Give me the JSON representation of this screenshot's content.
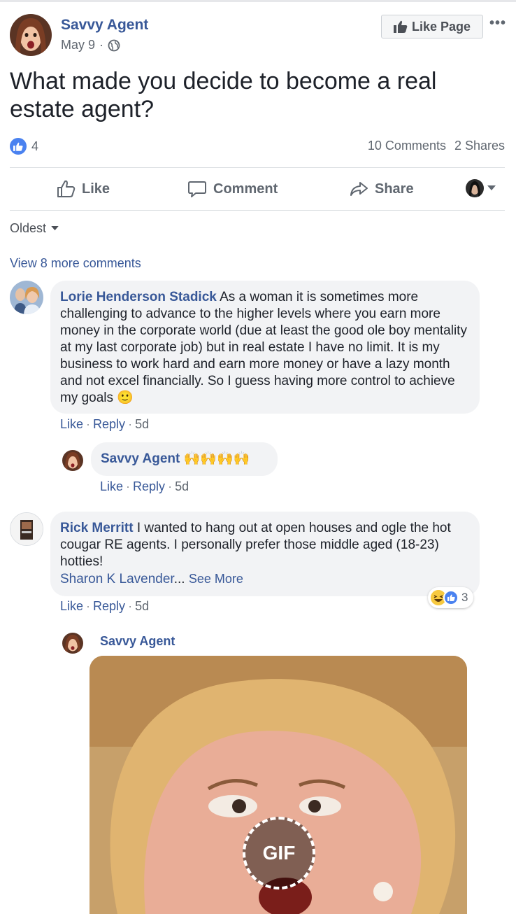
{
  "post": {
    "author": "Savvy Agent",
    "date": "May 9",
    "date_separator": "·",
    "like_page_label": "Like Page",
    "more_label": "•••",
    "text": "What made you decide to become a real estate agent?",
    "reaction_count": "4",
    "comments_count": "10 Comments",
    "shares_count": "2 Shares"
  },
  "actions": {
    "like": "Like",
    "comment": "Comment",
    "share": "Share"
  },
  "comments_section": {
    "sort_label": "Oldest",
    "view_more": "View 8 more comments"
  },
  "comments": [
    {
      "author": "Lorie Henderson Stadick",
      "text": "As a woman it is sometimes more challenging to advance to the higher levels where you earn more money in the corporate world (due at least the good ole boy mentality at my last corporate job) but in real estate I have no limit. It is my business to work hard and earn more money or have a lazy month and not excel financially. So I guess having more control to achieve my goals",
      "emoji": "🙂",
      "like": "Like",
      "reply": "Reply",
      "time": "5d"
    },
    {
      "author": "Savvy Agent",
      "text": "🙌🙌🙌🙌",
      "like": "Like",
      "reply": "Reply",
      "time": "5d"
    },
    {
      "author": "Rick Merritt",
      "text": "I wanted to hang out at open houses and ogle the hot cougar RE agents. I personally prefer those middle aged (18-23) hotties!",
      "mention": "Sharon K Lavender",
      "ellipsis": "...",
      "see_more": "See More",
      "reaction_count": "3",
      "like": "Like",
      "reply": "Reply",
      "time": "5d"
    },
    {
      "author": "Savvy Agent",
      "gif_label": "GIF"
    }
  ],
  "colors": {
    "link_blue": "#385898",
    "like_blue": "#4a82f0",
    "bubble_bg": "#f2f3f5",
    "muted_text": "#606770"
  },
  "icons": [
    "globe-icon",
    "thumbs-up-icon",
    "comment-icon",
    "share-icon",
    "chevron-down-icon",
    "haha-emoji-icon"
  ]
}
